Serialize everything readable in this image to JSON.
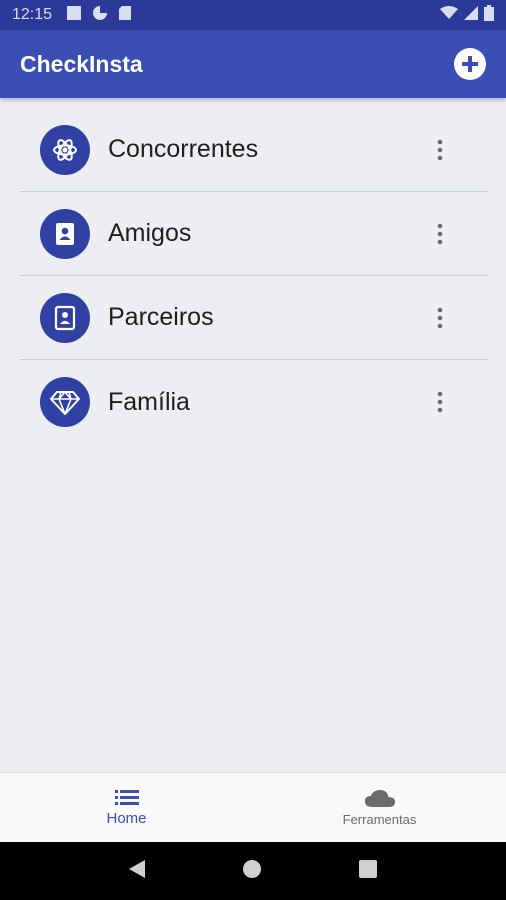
{
  "status_bar": {
    "time": "12:15",
    "icons_left": [
      "stop-square-icon",
      "data-saver-icon",
      "sd-card-icon"
    ],
    "icons_right": [
      "wifi-icon",
      "cell-signal-icon",
      "battery-icon"
    ]
  },
  "app_bar": {
    "title": "CheckInsta",
    "action_icon": "add-circle-icon"
  },
  "list": {
    "items": [
      {
        "label": "Concorrentes",
        "icon": "atom-icon"
      },
      {
        "label": "Amigos",
        "icon": "contacts-book-icon"
      },
      {
        "label": "Parceiros",
        "icon": "contact-card-icon"
      },
      {
        "label": "Família",
        "icon": "diamond-icon"
      }
    ]
  },
  "bottom_nav": {
    "tabs": [
      {
        "label": "Home",
        "icon": "list-icon",
        "active": true
      },
      {
        "label": "Ferramentas",
        "icon": "cloud-icon",
        "active": false
      }
    ]
  },
  "colors": {
    "status_bar": "#2b3a98",
    "primary": "#3a4eb4",
    "avatar": "#3141a3",
    "background": "#eceef1"
  }
}
